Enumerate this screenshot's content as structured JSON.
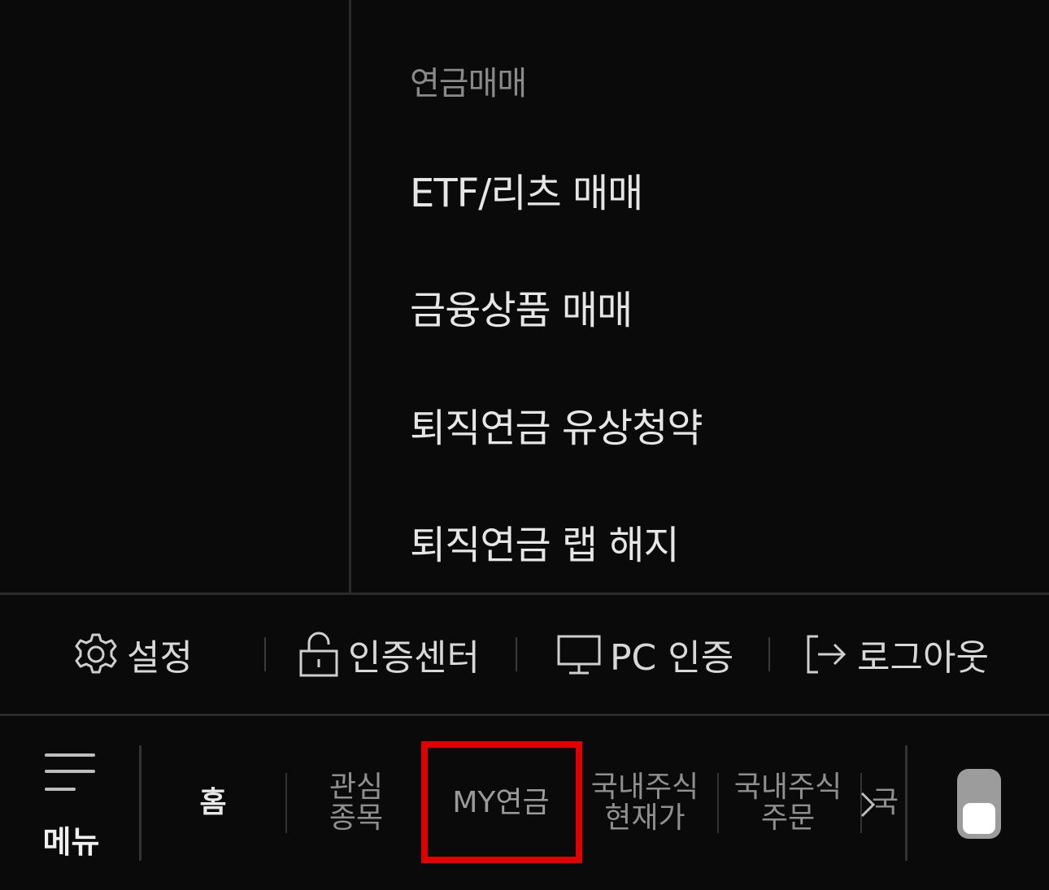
{
  "menu": {
    "section_title": "연금매매",
    "items": [
      {
        "label": "ETF/리츠 매매"
      },
      {
        "label": "금융상품 매매"
      },
      {
        "label": "퇴직연금 유상청약"
      },
      {
        "label": "퇴직연금 랩 해지"
      }
    ]
  },
  "utility": {
    "settings": {
      "label": "설정",
      "icon": "gear-icon"
    },
    "auth_center": {
      "label": "인증센터",
      "icon": "lock-icon"
    },
    "pc_auth": {
      "label": "PC 인증",
      "icon": "monitor-icon"
    },
    "logout": {
      "label": "로그아웃",
      "icon": "logout-icon"
    }
  },
  "tab_bar": {
    "menu_label": "메뉴",
    "tabs": [
      {
        "label": "홈"
      },
      {
        "label": "관심\n종목"
      },
      {
        "label": "MY연금"
      },
      {
        "label": "국내주식\n현재가"
      },
      {
        "label": "국내주식\n주문"
      },
      {
        "label": "국"
      }
    ]
  },
  "colors": {
    "background": "#0a0a0a",
    "highlight": "#e00000",
    "divider": "#2a2a2a",
    "text_primary": "#e6e6e6",
    "text_muted": "#8a8a8a"
  }
}
